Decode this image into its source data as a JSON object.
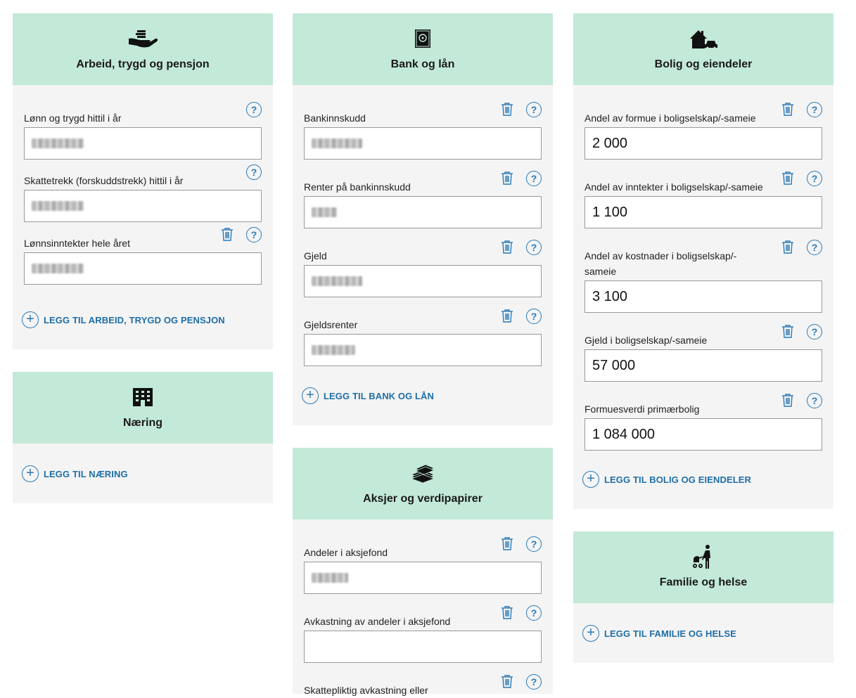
{
  "common": {
    "help_glyph": "?",
    "plus_glyph": "+"
  },
  "arbeid": {
    "title": "Arbeid, trygd og pensjon",
    "fields": [
      {
        "label": "Lønn og trygd hittil i år",
        "value": "",
        "blurred": true
      },
      {
        "label": "Skattetrekk (forskuddstrekk) hittil i år",
        "value": "",
        "blurred": true
      },
      {
        "label": "Lønnsinntekter hele året",
        "value": "",
        "blurred": true
      }
    ],
    "add_label": "LEGG TIL ARBEID, TRYGD OG PENSJON"
  },
  "naering": {
    "title": "Næring",
    "add_label": "LEGG TIL NÆRING"
  },
  "bank": {
    "title": "Bank og lån",
    "fields": [
      {
        "label": "Bankinnskudd",
        "value": "",
        "blurred": true
      },
      {
        "label": "Renter på bankinnskudd",
        "value": "",
        "blurred": true
      },
      {
        "label": "Gjeld",
        "value": "",
        "blurred": true
      },
      {
        "label": "Gjeldsrenter",
        "value": "",
        "blurred": true
      }
    ],
    "add_label": "LEGG TIL BANK OG LÅN"
  },
  "aksjer": {
    "title": "Aksjer og verdipapirer",
    "fields": [
      {
        "label": "Andeler i aksjefond",
        "value": "",
        "blurred": true
      },
      {
        "label": "Avkastning av andeler i aksjefond",
        "value": ""
      },
      {
        "label": "Skattepliktig avkastning eller",
        "value": ""
      }
    ]
  },
  "bolig": {
    "title": "Bolig og eiendeler",
    "fields": [
      {
        "label": "Andel av formue i boligselskap/-sameie",
        "value": "2 000"
      },
      {
        "label": "Andel av inntekter i boligselskap/-sameie",
        "value": "1 100"
      },
      {
        "label": "Andel av kostnader i boligselskap/-sameie",
        "value": "3 100"
      },
      {
        "label": "Gjeld i boligselskap/-sameie",
        "value": "57 000"
      },
      {
        "label": "Formuesverdi primærbolig",
        "value": "1 084 000"
      }
    ],
    "add_label": "LEGG TIL BOLIG OG EIENDELER"
  },
  "familie": {
    "title": "Familie og helse",
    "add_label": "LEGG TIL FAMILIE OG HELSE"
  },
  "colors": {
    "header_bg": "#c3e9d9",
    "card_bg": "#f4f4f4",
    "accent": "#2a7ab8"
  }
}
